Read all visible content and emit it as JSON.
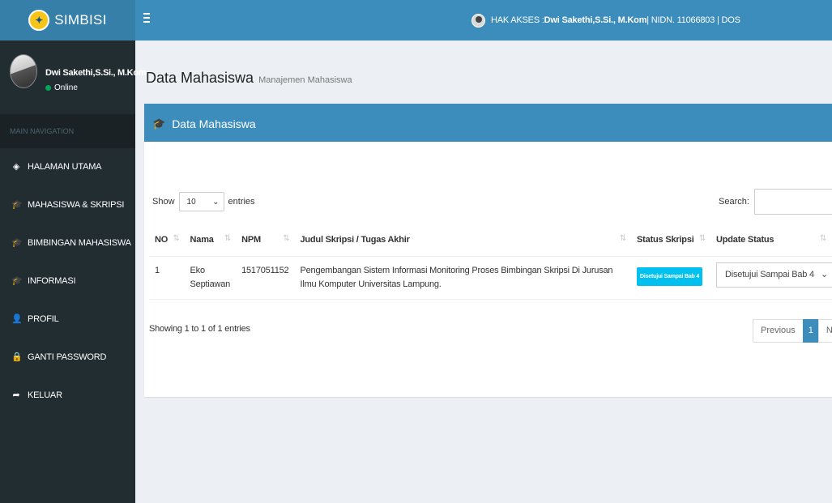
{
  "app": {
    "logo_text": "SIMBISI"
  },
  "topbar": {
    "access_prefix": "HAK AKSES : ",
    "access_name": "Dwi Sakethi,S.Si., M.Kom",
    "access_suffix": " | NIDN. 11066803 | DOS"
  },
  "sidebar": {
    "user_name": "Dwi Sakethi,S.Si., M.Kom",
    "user_status": "Online",
    "nav_header": "MAIN NAVIGATION",
    "items": [
      {
        "label": "HALAMAN UTAMA",
        "icon": "dashboard-icon",
        "glyph": "◈"
      },
      {
        "label": "MAHASISWA & SKRIPSI",
        "icon": "graduation-cap-icon",
        "glyph": "🎓"
      },
      {
        "label": "BIMBINGAN MAHASISWA",
        "icon": "graduation-cap-icon",
        "glyph": "🎓"
      },
      {
        "label": "INFORMASI",
        "icon": "graduation-cap-icon",
        "glyph": "🎓"
      },
      {
        "label": "PROFIL",
        "icon": "user-icon",
        "glyph": "👤"
      },
      {
        "label": "GANTI PASSWORD",
        "icon": "lock-icon",
        "glyph": "🔒"
      },
      {
        "label": "KELUAR",
        "icon": "share-icon",
        "glyph": "➦"
      }
    ]
  },
  "page": {
    "title": "Data Mahasiswa",
    "subtitle": "Manajemen Mahasiswa"
  },
  "box": {
    "title": "Data Mahasiswa"
  },
  "table_controls": {
    "show_label": "Show",
    "entries_value": "10",
    "entries_label": "entries",
    "search_label": "Search:"
  },
  "table": {
    "headers": [
      "NO",
      "Nama",
      "NPM",
      "Judul Skripsi / Tugas Akhir",
      "Status Skripsi",
      "Update Status"
    ],
    "rows": [
      {
        "no": "1",
        "nama": "Eko Septiawan",
        "npm": "1517051152",
        "judul": "Pengembangan Sistem Informasi Monitoring Proses Bimbingan Skripsi Di Jurusan Ilmu Komputer Universitas Lampung.",
        "status": "Disetujui Sampai Bab 4",
        "update_status": "Disetujui Sampai Bab 4"
      }
    ]
  },
  "footer": {
    "info": "Showing 1 to 1 of 1 entries",
    "previous": "Previous",
    "page": "1",
    "next": "Next"
  },
  "colors": {
    "header": "#3c8dbc",
    "logo": "#367fa9",
    "sidebar": "#222d32",
    "badge": "#00c0ef",
    "online": "#00a65a"
  }
}
